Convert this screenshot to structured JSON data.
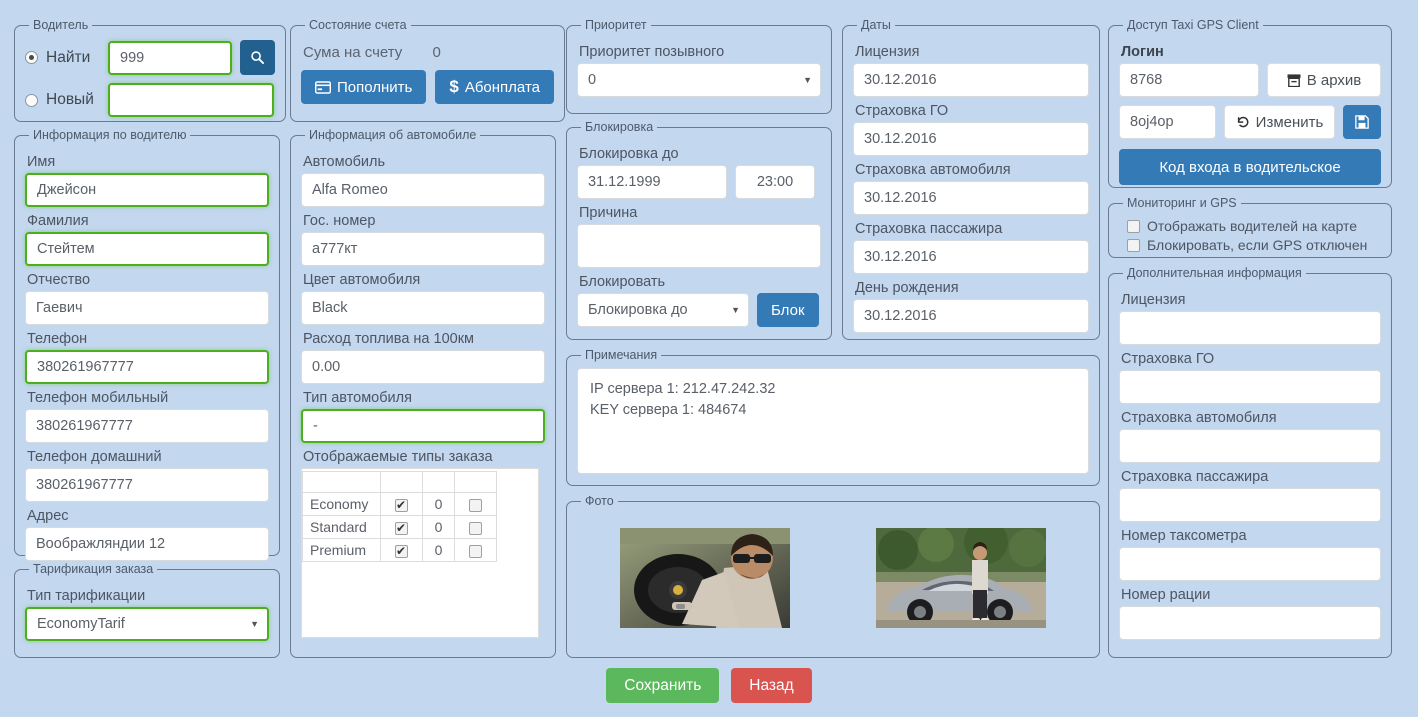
{
  "driver_panel": {
    "legend": "Водитель",
    "find_label": "Найти",
    "find_value": "999",
    "new_label": "Новый",
    "new_value": "",
    "search_icon": "search-icon"
  },
  "driver_info": {
    "legend": "Информация по водителю",
    "fields": [
      {
        "label": "Имя",
        "value": "Джейсон",
        "highlight": true
      },
      {
        "label": "Фамилия",
        "value": "Стейтем",
        "highlight": true
      },
      {
        "label": "Отчество",
        "value": "Гаевич",
        "highlight": false
      },
      {
        "label": "Телефон",
        "value": "380261967777",
        "highlight": true
      },
      {
        "label": "Телефон мобильный",
        "value": "380261967777",
        "highlight": false
      },
      {
        "label": "Телефон домашний",
        "value": "380261967777",
        "highlight": false
      },
      {
        "label": "Адрес",
        "value": "Воображляндии 12",
        "highlight": false
      }
    ]
  },
  "tarif": {
    "legend": "Тарификация заказа",
    "label": "Тип тарификации",
    "value": "EconomyTarif"
  },
  "account": {
    "legend": "Состояние счета",
    "sum_label": "Сума на счету",
    "sum_value": "0",
    "topup_label": "Пополнить",
    "topup_icon": "credit-card-icon",
    "subscription_label": "Абонплата",
    "subscription_icon": "dollar-icon"
  },
  "car_info": {
    "legend": "Информация об автомобиле",
    "fields": [
      {
        "label": "Автомобиль",
        "value": "Alfa Romeo",
        "highlight": false
      },
      {
        "label": "Гос. номер",
        "value": "а777кт",
        "highlight": false
      },
      {
        "label": "Цвет автомобиля",
        "value": "Black",
        "highlight": false
      },
      {
        "label": "Расход топлива на 100км",
        "value": "0.00",
        "highlight": false
      },
      {
        "label": "Тип автомобиля",
        "value": "-",
        "highlight": true
      }
    ],
    "order_types_label": "Отображаемые типы заказа",
    "order_types": [
      {
        "name": "Economy",
        "enabled": true,
        "count": "0",
        "extra": false
      },
      {
        "name": "Standard",
        "enabled": true,
        "count": "0",
        "extra": false
      },
      {
        "name": "Premium",
        "enabled": true,
        "count": "0",
        "extra": false
      }
    ]
  },
  "priority": {
    "legend": "Приоритет",
    "label": "Приоритет позывного",
    "value": "0"
  },
  "blocking": {
    "legend": "Блокировка",
    "until_label": "Блокировка до",
    "until_date": "31.12.1999",
    "until_time": "23:00",
    "reason_label": "Причина",
    "reason_value": "",
    "action_label": "Блокировать",
    "action_value": "Блокировка до",
    "block_button": "Блок"
  },
  "dates": {
    "legend": "Даты",
    "fields": [
      {
        "label": "Лицензия",
        "value": "30.12.2016"
      },
      {
        "label": "Страховка ГО",
        "value": "30.12.2016"
      },
      {
        "label": "Страховка автомобиля",
        "value": "30.12.2016"
      },
      {
        "label": "Страховка пассажира",
        "value": "30.12.2016"
      },
      {
        "label": "День рождения",
        "value": "30.12.2016"
      }
    ]
  },
  "notes": {
    "legend": "Примечания",
    "line1": "IP сервера 1: 212.47.242.32",
    "line2": "KEY сервера 1: 484674"
  },
  "photo": {
    "legend": "Фото",
    "photo1_name": "driver-photo-steering-wheel",
    "photo2_name": "driver-photo-with-car"
  },
  "gps_access": {
    "legend": "Доступ Taxi GPS Client",
    "login_label": "Логин",
    "login_value": "8768",
    "archive_label": "В архив",
    "archive_icon": "archive-box-icon",
    "password_value": "8oj4op",
    "change_label": "Изменить",
    "change_icon": "undo-icon",
    "save_icon": "floppy-save-icon",
    "code_button": "Код входа в водительское"
  },
  "monitoring": {
    "legend": "Мониторинг и GPS",
    "show_drivers_label": "Отображать водителей на карте",
    "show_drivers_checked": false,
    "block_gps_label": "Блокировать, если GPS отключен",
    "block_gps_checked": false
  },
  "extra_info": {
    "legend": "Дополнительная информация",
    "fields": [
      {
        "label": "Лицензия",
        "value": ""
      },
      {
        "label": "Страховка ГО",
        "value": ""
      },
      {
        "label": "Страховка автомобиля",
        "value": ""
      },
      {
        "label": "Страховка пассажира",
        "value": ""
      },
      {
        "label": "Номер таксометра",
        "value": ""
      },
      {
        "label": "Номер рации",
        "value": ""
      }
    ]
  },
  "footer": {
    "save_label": "Сохранить",
    "back_label": "Назад"
  },
  "colors": {
    "background": "#c3d7ef",
    "primary_blue": "#337ab7",
    "dark_blue": "#22618f",
    "green": "#5cb85c",
    "red": "#d9534f",
    "highlight_border": "#4caf1e"
  }
}
